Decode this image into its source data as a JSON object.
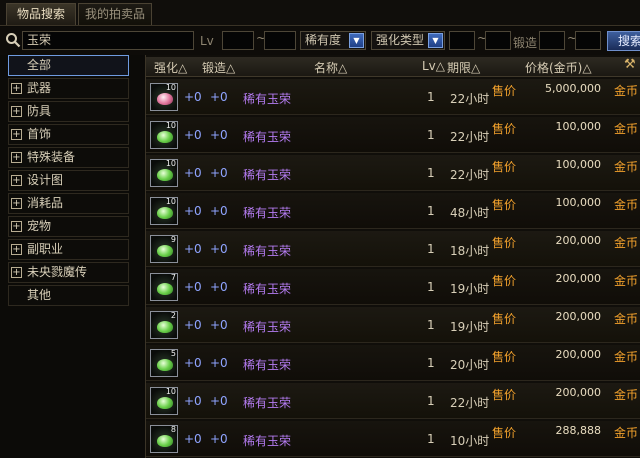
{
  "tabs": [
    {
      "label": "物品搜索"
    },
    {
      "label": "我的拍卖品"
    }
  ],
  "search": {
    "query": "玉荣",
    "lv_label": "Lv",
    "lv_min": "",
    "tilde1": "~",
    "lv_max": "",
    "rarity_selected": "稀有度",
    "enhance_type_selected": "强化类型",
    "enh_min": "",
    "tilde2": "~",
    "enh_max": "",
    "forge_label": "锻造",
    "forge_min": "",
    "tilde3": "~",
    "forge_max": "",
    "button_label": "搜索"
  },
  "categories": [
    {
      "label": "全部",
      "expandable": false
    },
    {
      "label": "武器",
      "expandable": true
    },
    {
      "label": "防具",
      "expandable": true
    },
    {
      "label": "首饰",
      "expandable": true
    },
    {
      "label": "特殊装备",
      "expandable": true
    },
    {
      "label": "设计图",
      "expandable": true
    },
    {
      "label": "消耗品",
      "expandable": true
    },
    {
      "label": "宠物",
      "expandable": true
    },
    {
      "label": "副职业",
      "expandable": true
    },
    {
      "label": "未央戮魔传",
      "expandable": true
    },
    {
      "label": "其他",
      "expandable": false
    }
  ],
  "table": {
    "headers": {
      "enhance": "强化△",
      "forge": "锻造△",
      "name": "名称△",
      "lv": "Lv△",
      "period": "期限△",
      "price": "价格(金币)△"
    },
    "rows": [
      {
        "icon_level": "10",
        "icon_color": "pink",
        "enhance": "+0",
        "forge": "+0",
        "name": "稀有玉荣",
        "lv": "1",
        "period": "22小时",
        "sell": "售价",
        "price": "5,000,000",
        "currency": "金币"
      },
      {
        "icon_level": "10",
        "icon_color": "green",
        "enhance": "+0",
        "forge": "+0",
        "name": "稀有玉荣",
        "lv": "1",
        "period": "22小时",
        "sell": "售价",
        "price": "100,000",
        "currency": "金币"
      },
      {
        "icon_level": "10",
        "icon_color": "green",
        "enhance": "+0",
        "forge": "+0",
        "name": "稀有玉荣",
        "lv": "1",
        "period": "22小时",
        "sell": "售价",
        "price": "100,000",
        "currency": "金币"
      },
      {
        "icon_level": "10",
        "icon_color": "green",
        "enhance": "+0",
        "forge": "+0",
        "name": "稀有玉荣",
        "lv": "1",
        "period": "48小时",
        "sell": "售价",
        "price": "100,000",
        "currency": "金币"
      },
      {
        "icon_level": "9",
        "icon_color": "green",
        "enhance": "+0",
        "forge": "+0",
        "name": "稀有玉荣",
        "lv": "1",
        "period": "18小时",
        "sell": "售价",
        "price": "200,000",
        "currency": "金币"
      },
      {
        "icon_level": "7",
        "icon_color": "green",
        "enhance": "+0",
        "forge": "+0",
        "name": "稀有玉荣",
        "lv": "1",
        "period": "19小时",
        "sell": "售价",
        "price": "200,000",
        "currency": "金币"
      },
      {
        "icon_level": "2",
        "icon_color": "green",
        "enhance": "+0",
        "forge": "+0",
        "name": "稀有玉荣",
        "lv": "1",
        "period": "19小时",
        "sell": "售价",
        "price": "200,000",
        "currency": "金币"
      },
      {
        "icon_level": "5",
        "icon_color": "green",
        "enhance": "+0",
        "forge": "+0",
        "name": "稀有玉荣",
        "lv": "1",
        "period": "20小时",
        "sell": "售价",
        "price": "200,000",
        "currency": "金币"
      },
      {
        "icon_level": "10",
        "icon_color": "green",
        "enhance": "+0",
        "forge": "+0",
        "name": "稀有玉荣",
        "lv": "1",
        "period": "22小时",
        "sell": "售价",
        "price": "200,000",
        "currency": "金币"
      },
      {
        "icon_level": "8",
        "icon_color": "green",
        "enhance": "+0",
        "forge": "+0",
        "name": "稀有玉荣",
        "lv": "1",
        "period": "10小时",
        "sell": "售价",
        "price": "288,888",
        "currency": "金币"
      }
    ]
  }
}
